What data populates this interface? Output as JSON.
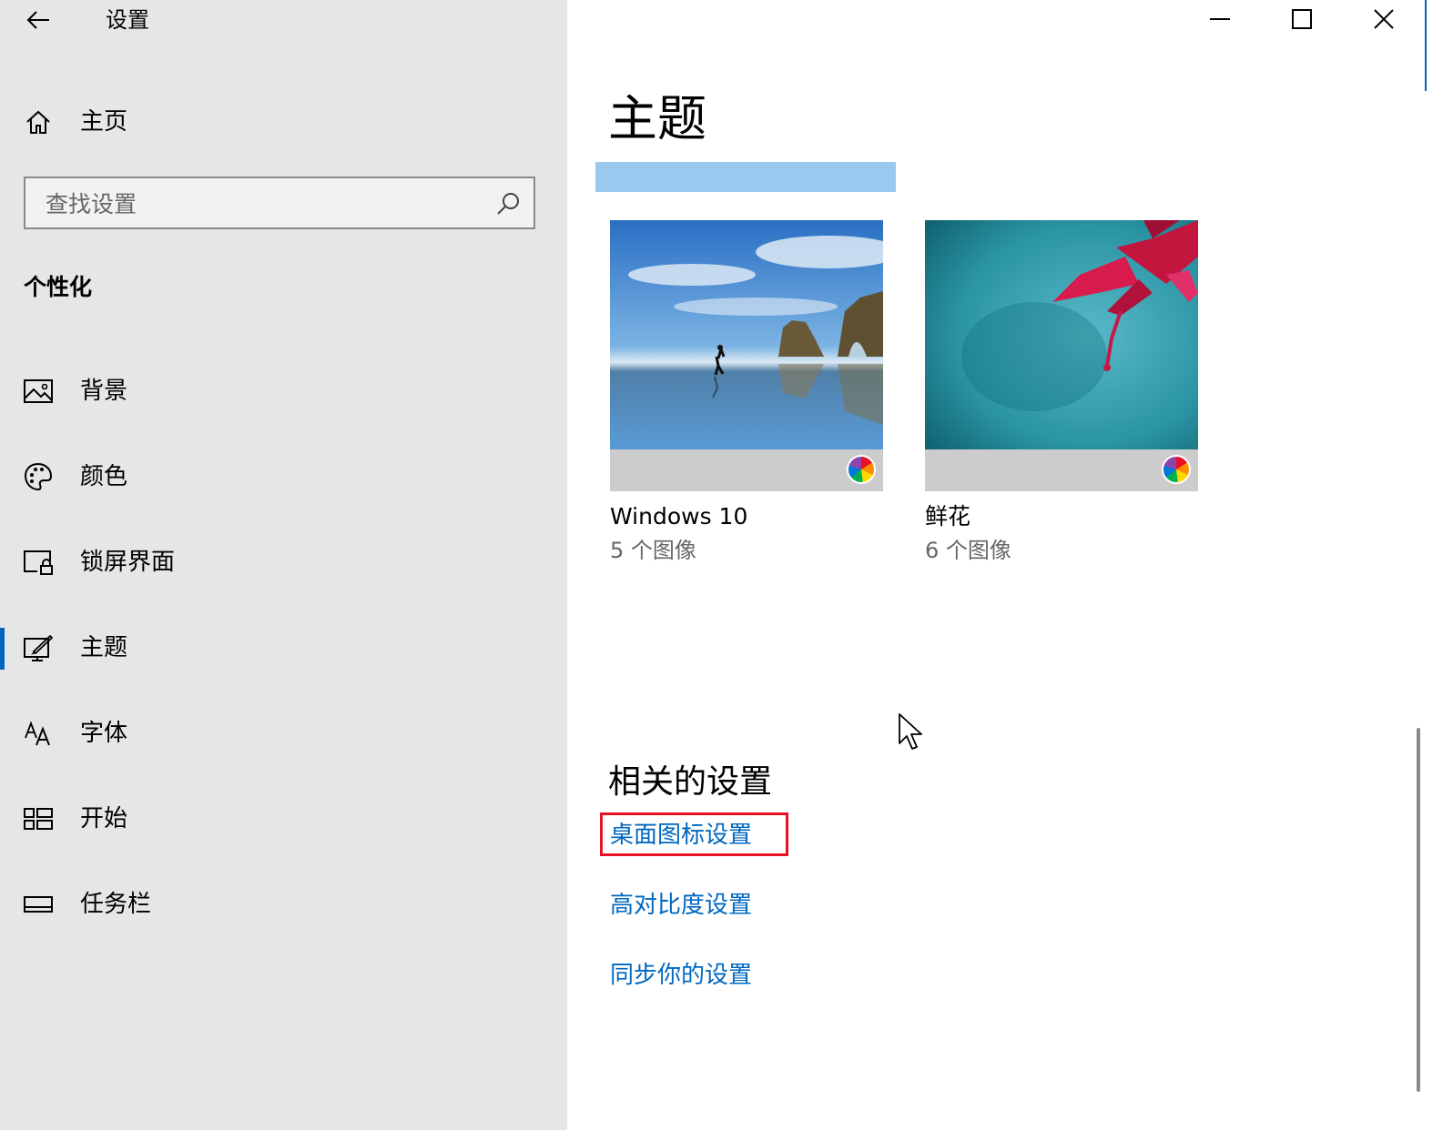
{
  "window": {
    "title": "设置",
    "controls": {
      "minimize": "minimize-icon",
      "maximize": "maximize-icon",
      "close": "close-icon"
    }
  },
  "sidebar": {
    "home_label": "主页",
    "search": {
      "placeholder": "查找设置",
      "value": ""
    },
    "section_title": "个性化",
    "items": [
      {
        "label": "背景",
        "icon": "picture-icon"
      },
      {
        "label": "颜色",
        "icon": "palette-icon"
      },
      {
        "label": "锁屏界面",
        "icon": "lock-screen-icon"
      },
      {
        "label": "主题",
        "icon": "theme-icon",
        "active": true
      },
      {
        "label": "字体",
        "icon": "font-icon"
      },
      {
        "label": "开始",
        "icon": "start-icon"
      },
      {
        "label": "任务栏",
        "icon": "taskbar-icon"
      }
    ]
  },
  "main": {
    "title": "主题",
    "themes": [
      {
        "name": "Windows 10",
        "count": "5 个图像"
      },
      {
        "name": "鲜花",
        "count": "6 个图像"
      }
    ],
    "related": {
      "title": "相关的设置",
      "links": [
        "桌面图标设置",
        "高对比度设置",
        "同步你的设置"
      ]
    }
  },
  "colors": {
    "accent": "#0067c0",
    "highlight": "#e81123",
    "selection": "#99c9ef"
  }
}
